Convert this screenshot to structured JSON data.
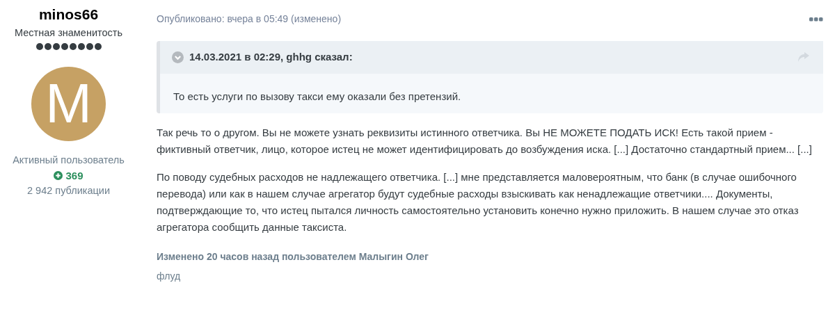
{
  "author": {
    "name": "minos66",
    "title": "Местная знаменитость",
    "stars": 8,
    "avatar_letter": "M",
    "group": "Активный пользователь",
    "reputation": "369",
    "posts": "2 942 публикации"
  },
  "post": {
    "published": "Опубликовано: вчера в 05:49 (изменено)",
    "quote": {
      "header": "14.03.2021 в 02:29, ghhg сказал:",
      "text": "То есть услуги по вызову такси ему оказали без претензий."
    },
    "paragraphs": [
      "Так речь то о другом. Вы не можете узнать реквизиты истинного ответчика. Вы НЕ МОЖЕТЕ ПОДАТЬ ИСК! Есть такой прием - фиктивный ответчик, лицо, которое истец не может идентифицировать до возбуждения иска. [...] Достаточно стандартный прием... [...]",
      "По поводу судебных расходов не надлежащего ответчика. [...] мне представляется маловероятным, что банк (в случае ошибочного перевода) или как в нашем случае агрегатор будут судебные расходы взыскивать как ненадлежащие ответчики.... Документы, подтверждающие то, что истец пытался личность самостоятельно установить конечно нужно приложить. В нашем случае это отказ агрегатора сообщить данные таксиста."
    ],
    "edited": "Изменено 20 часов назад пользователем Малыгин Олег",
    "edit_reason": "флуд"
  }
}
